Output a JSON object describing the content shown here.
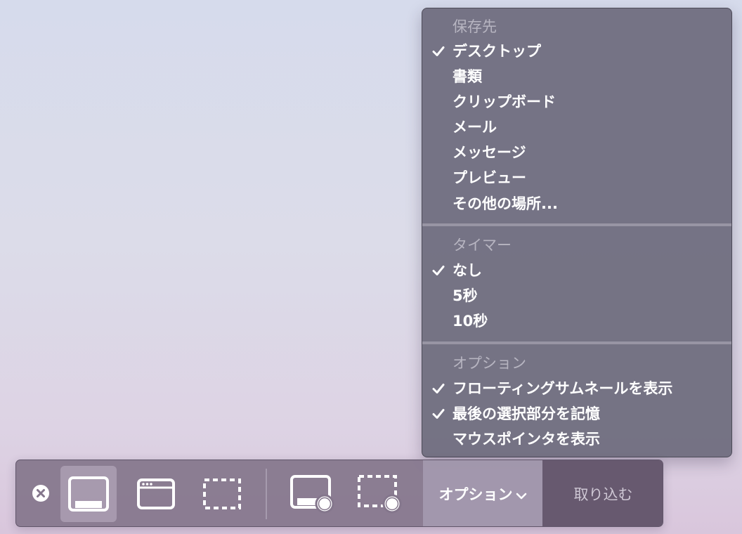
{
  "menu": {
    "sections": {
      "save_to": {
        "title": "保存先",
        "items": [
          {
            "label": "デスクトップ",
            "checked": true
          },
          {
            "label": "書類",
            "checked": false
          },
          {
            "label": "クリップボード",
            "checked": false
          },
          {
            "label": "メール",
            "checked": false
          },
          {
            "label": "メッセージ",
            "checked": false
          },
          {
            "label": "プレビュー",
            "checked": false
          },
          {
            "label": "その他の場所...",
            "checked": false
          }
        ]
      },
      "timer": {
        "title": "タイマー",
        "items": [
          {
            "label": "なし",
            "checked": true
          },
          {
            "label": "5秒",
            "checked": false
          },
          {
            "label": "10秒",
            "checked": false
          }
        ]
      },
      "options": {
        "title": "オプション",
        "items": [
          {
            "label": "フローティングサムネールを表示",
            "checked": true
          },
          {
            "label": "最後の選択部分を記憶",
            "checked": true
          },
          {
            "label": "マウスポインタを表示",
            "checked": false
          }
        ]
      }
    }
  },
  "toolbar": {
    "close_icon": "close-circle-icon",
    "tools": [
      {
        "icon": "capture-entire-screen-icon",
        "selected": true
      },
      {
        "icon": "capture-selected-window-icon",
        "selected": false
      },
      {
        "icon": "capture-selected-portion-icon",
        "selected": false
      },
      {
        "icon": "record-entire-screen-icon",
        "selected": false
      },
      {
        "icon": "record-selected-portion-icon",
        "selected": false
      }
    ],
    "options_label": "オプション",
    "capture_label": "取り込む"
  },
  "colors": {
    "menu_bg": "#706e80",
    "toolbar_bg": "#84768c",
    "text": "#ffffff",
    "section_title": "#cdcbd6"
  }
}
